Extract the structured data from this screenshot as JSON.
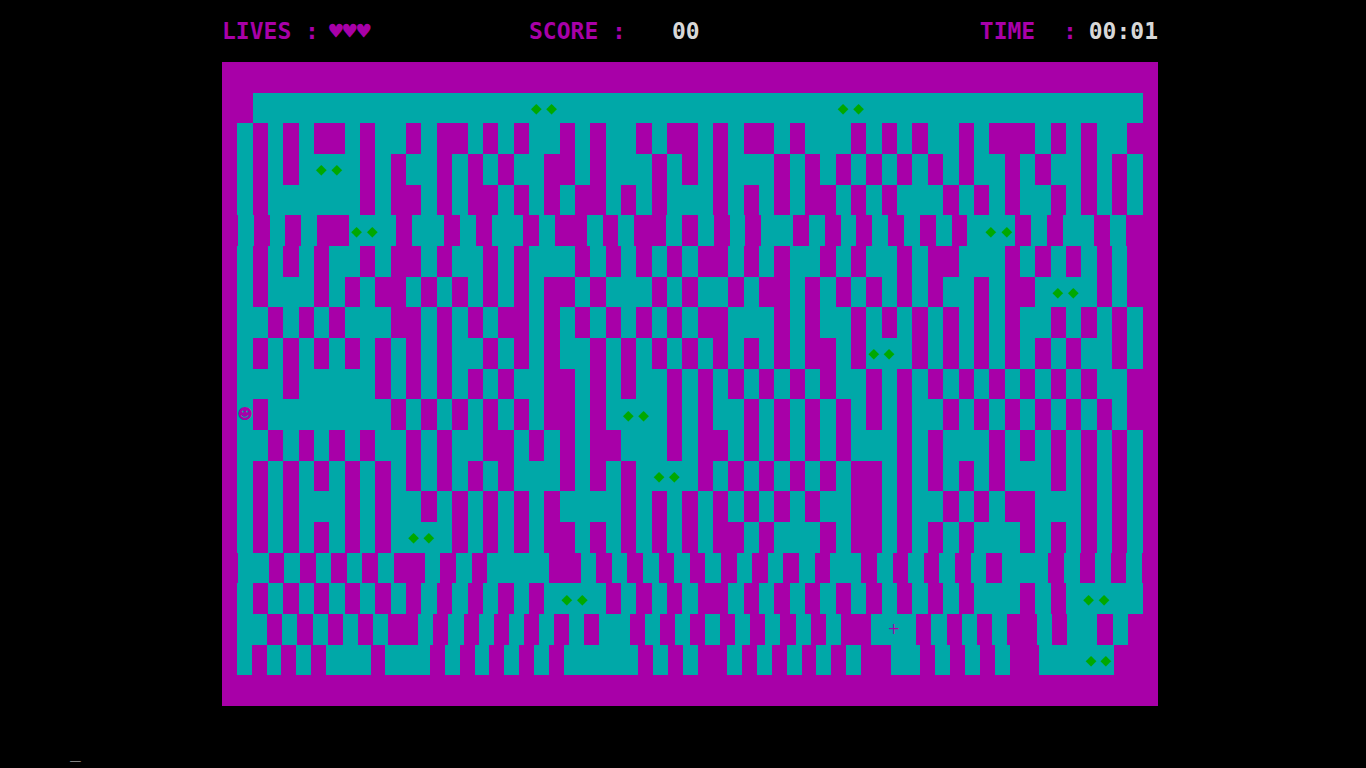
{
  "header": {
    "lives_label": "LIVES :",
    "lives": "♥♥♥",
    "score_label": "SCORE :",
    "score": "00",
    "time_label": "TIME  :",
    "time": "00:01"
  },
  "maze": {
    "wall": "#",
    "floor": ".",
    "rows": [
      "#############################################################",
      "##..................◆◆..................◆◆..................#",
      "#.#.#.##.#..#.##.#.#..#.#..#.##.#.##.#...#.#.#..#.###.#.#..##",
      "#.#.#.◆◆.#.#..#.#.#..##.#...#.#.#...#.#.#.#.#.#.#..#.#..#.#.#",
      "#.#......#.##.#.##.#.#.##.#.#...#.#.#.##.#.#...#.#.#..#.#.#.#",
      "#.#.#.##◆◆.#..#.#..#.##.#.##.#.#.#..#.#.#.#.#.#.◆◆#.#..#.##",
      "#.#.#.#..#.##.#..#.#...#.#.#.#.##.#.#..#.#..#.##...#.#.#.#.##",
      "#.#...#.#.##.#.#.#.#.##.#...#.#..#.##.#.#.#.#.#..#.##.◆◆.#.##",
      "#..#.#.#...##.#.#.##.#.#.#.#.#.##...#.#..#.#.#.#.#.#..#.#.#.#",
      "#.#.#.#.#.#.#.#..#.#.#..#.#.#.#.#.#.#.##.#◆◆.#.#.#.#.#.#..#.#",
      "#...#.....#.#.#.#.#..##.#.#..#.#.#.#.#.#..#.#.#.#.#.#.#.#..##",
      "#☻#........#.#.#.#.#.##.#.◆◆.#.#..#.#.#.#.#.#..#.#.#.#.#.#.##",
      "#..#.#.#.#..#.#..##.#.#.##...#.##.#.#.#.#...#.#...#.#.#.#.#.#",
      "#.#.#.#.#.#.#.#.#.#...#.#.#.◆◆.#.#.#.#.#.##.#.#.#.#...#.#.#.#",
      "#.#.#...#.#..#.#.#.#.#....#.#.#.#.#.#.#..##.#..#.#.##...#.#.#",
      "#.#.#.#.#.#.◆◆.#.#.#.##.#.#.#.#.##.#...#.##.#.#.#...#.#.#.#.#",
      "#..#.#.#.#.##.#.#....##.#.#.#.#.#.#.#.#..#.#.#.#.#...#.#.#.#",
      "#.#.#.#.#.#.#.#.#.#.#.◆◆.#.#.#.##.#.#.#.#.#.#.#.#...#.#.◆◆..#",
      "#..#.#.#.#.##.#.#.#.#.#.#..#.#.#.#.#.#.#.##.+.#.#.#.##.#..#.##",
      "#.#.#.#...#...#.#.#.#.#.....#.#.##.#.#.#.#.##..#.#.#.##...◆◆###",
      "#############################################################"
    ]
  },
  "prompt": "_"
}
